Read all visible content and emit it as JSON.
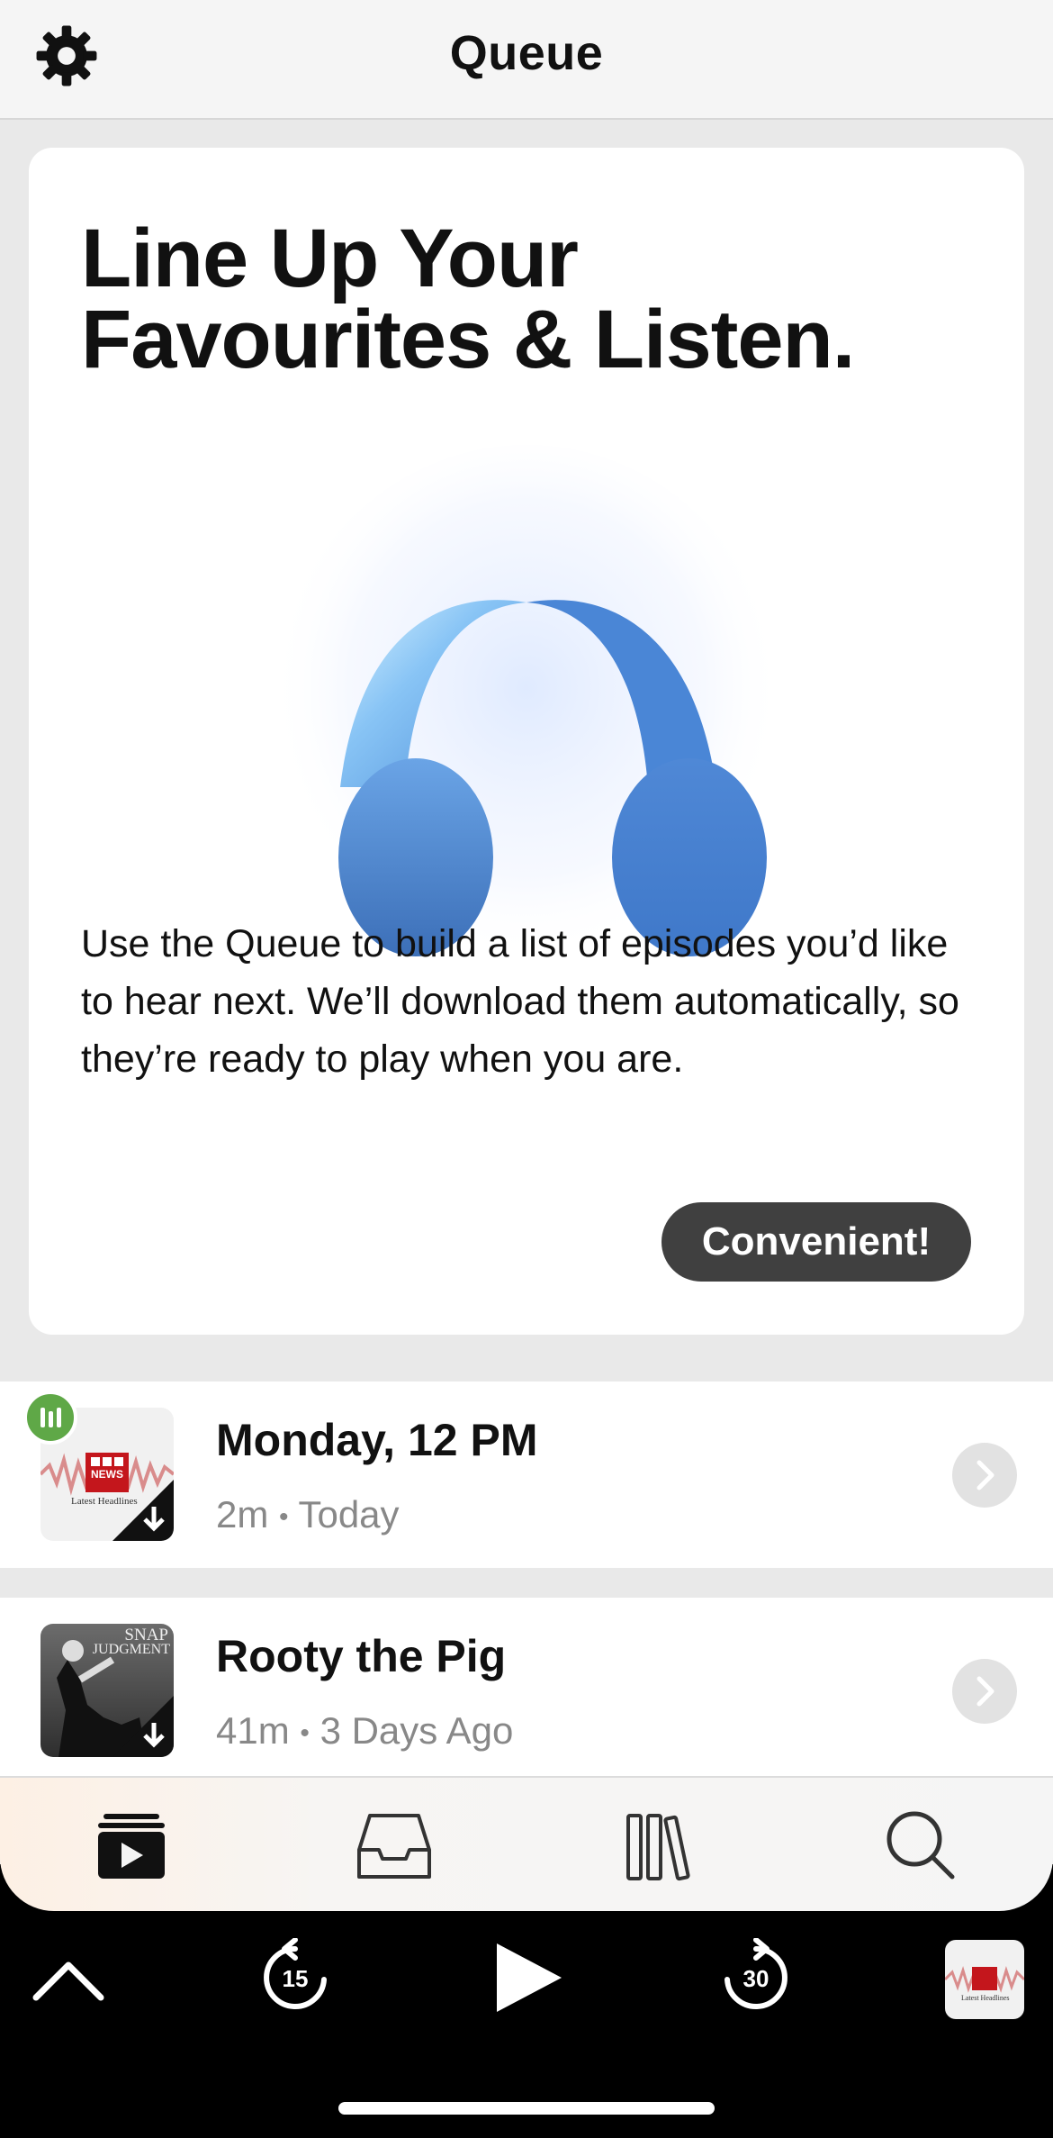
{
  "header": {
    "title": "Queue",
    "settings_icon": "gear-icon"
  },
  "promo": {
    "headline_line1": "Line Up Your",
    "headline_line2": "Favourites & Listen.",
    "illustration": "headphones-icon",
    "description": "Use the Queue to build a list of episodes you’d like to hear next. We’ll download them automatically, so they’re ready to play when you are.",
    "button_label": "Convenient!"
  },
  "episodes": [
    {
      "title": "Monday, 12 PM",
      "duration": "2m",
      "separator": "•",
      "date": "Today",
      "artwork": {
        "brand": "BBC",
        "brand2": "NEWS",
        "caption": "Latest Headlines"
      },
      "playing": true,
      "downloaded": true
    },
    {
      "title": "Rooty the Pig",
      "duration": "41m",
      "separator": "•",
      "date": "3 Days Ago",
      "artwork": {
        "brand": "SNAP",
        "brand2": "JUDGMENT"
      },
      "playing": false,
      "downloaded": true
    }
  ],
  "tabs": [
    {
      "name": "queue",
      "icon": "queue-play-icon",
      "active": true
    },
    {
      "name": "inbox",
      "icon": "inbox-tray-icon",
      "active": false
    },
    {
      "name": "library",
      "icon": "library-books-icon",
      "active": false
    },
    {
      "name": "search",
      "icon": "search-icon",
      "active": false
    }
  ],
  "player": {
    "skip_back_seconds": "15",
    "skip_forward_seconds": "30",
    "now_playing_artwork": {
      "brand": "BBC",
      "brand2": "NEWS",
      "caption": "Latest Headlines"
    }
  },
  "colors": {
    "accent_green": "#5fa847",
    "cta_bg": "#404040",
    "headphone_blue": "#4a86d6"
  }
}
